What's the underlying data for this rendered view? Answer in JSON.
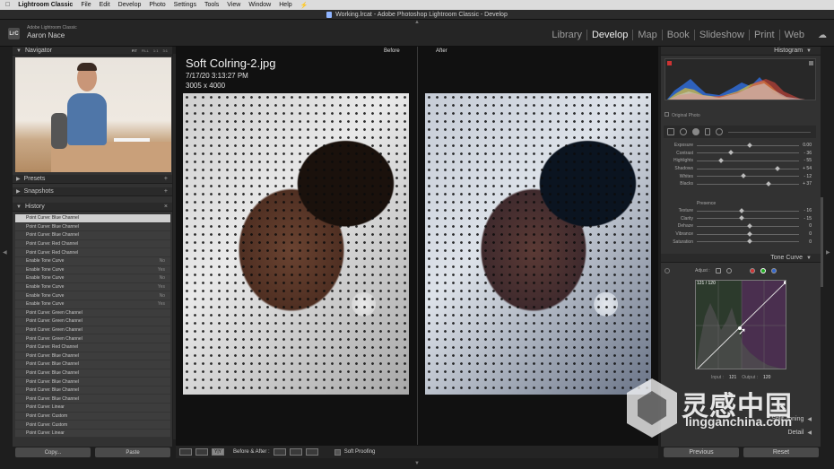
{
  "menubar": {
    "apple": "",
    "items": [
      "Lightroom Classic",
      "File",
      "Edit",
      "Develop",
      "Photo",
      "Settings",
      "Tools",
      "View",
      "Window",
      "Help"
    ],
    "right_icon": "⚡"
  },
  "window": {
    "title": "Working.lrcat - Adobe Photoshop Lightroom Classic - Develop"
  },
  "identity": {
    "logo": "LrC",
    "line1": "Adobe Lightroom Classic",
    "line2": "Aaron Nace"
  },
  "modules": {
    "items": [
      "Library",
      "Develop",
      "Map",
      "Book",
      "Slideshow",
      "Print",
      "Web"
    ],
    "active": "Develop",
    "cloud_icon": "☁"
  },
  "left": {
    "navigator": {
      "title": "Navigator",
      "zoom_options": [
        "FIT",
        "FILL",
        "1:1",
        "3:1"
      ]
    },
    "presets": {
      "title": "Presets"
    },
    "snapshots": {
      "title": "Snapshots"
    },
    "history": {
      "title": "History",
      "items": [
        {
          "label": "Point Curve: Blue Channel",
          "value": ""
        },
        {
          "label": "Point Curve: Blue Channel",
          "value": ""
        },
        {
          "label": "Point Curve: Blue Channel",
          "value": ""
        },
        {
          "label": "Point Curve: Red Channel",
          "value": ""
        },
        {
          "label": "Point Curve: Red Channel",
          "value": ""
        },
        {
          "label": "Enable Tone Curve",
          "value": "No"
        },
        {
          "label": "Enable Tone Curve",
          "value": "Yes"
        },
        {
          "label": "Enable Tone Curve",
          "value": "No"
        },
        {
          "label": "Enable Tone Curve",
          "value": "Yes"
        },
        {
          "label": "Enable Tone Curve",
          "value": "No"
        },
        {
          "label": "Enable Tone Curve",
          "value": "Yes"
        },
        {
          "label": "Point Curve: Green Channel",
          "value": ""
        },
        {
          "label": "Point Curve: Green Channel",
          "value": ""
        },
        {
          "label": "Point Curve: Green Channel",
          "value": ""
        },
        {
          "label": "Point Curve: Green Channel",
          "value": ""
        },
        {
          "label": "Point Curve: Red Channel",
          "value": ""
        },
        {
          "label": "Point Curve: Blue Channel",
          "value": ""
        },
        {
          "label": "Point Curve: Blue Channel",
          "value": ""
        },
        {
          "label": "Point Curve: Blue Channel",
          "value": ""
        },
        {
          "label": "Point Curve: Blue Channel",
          "value": ""
        },
        {
          "label": "Point Curve: Blue Channel",
          "value": ""
        },
        {
          "label": "Point Curve: Blue Channel",
          "value": ""
        },
        {
          "label": "Point Curve: Linear",
          "value": ""
        },
        {
          "label": "Point Curve: Custom",
          "value": ""
        },
        {
          "label": "Point Curve: Custom",
          "value": ""
        },
        {
          "label": "Point Curve: Linear",
          "value": ""
        }
      ]
    },
    "copy_label": "Copy...",
    "paste_label": "Paste"
  },
  "center": {
    "before_label": "Before",
    "after_label": "After",
    "filename": "Soft Colring-2.jpg",
    "datetime": "7/17/20 3:13:27 PM",
    "dimensions": "3005 x 4000"
  },
  "toolbar": {
    "view_label": "Before & After :",
    "soft_proofing": "Soft Proofing",
    "yy_label": "Y|Y"
  },
  "right": {
    "histogram_title": "Histogram",
    "original_photo": "Original Photo",
    "basic_sliders": [
      {
        "label": "Exposure",
        "value": "0.00",
        "pos": 0.5
      },
      {
        "label": "Contrast",
        "value": "- 36",
        "pos": 0.32
      },
      {
        "label": "Highlights",
        "value": "- 55",
        "pos": 0.22
      },
      {
        "label": "Shadows",
        "value": "+ 54",
        "pos": 0.77
      },
      {
        "label": "Whites",
        "value": "- 12",
        "pos": 0.44
      },
      {
        "label": "Blacks",
        "value": "+ 37",
        "pos": 0.68
      }
    ],
    "presence_title": "Presence",
    "presence_sliders": [
      {
        "label": "Texture",
        "value": "- 16",
        "pos": 0.42
      },
      {
        "label": "Clarity",
        "value": "- 15",
        "pos": 0.42
      },
      {
        "label": "Dehaze",
        "value": "0",
        "pos": 0.5
      },
      {
        "label": "Vibrance",
        "value": "0",
        "pos": 0.5
      },
      {
        "label": "Saturation",
        "value": "0",
        "pos": 0.5
      }
    ],
    "tone_curve_title": "Tone Curve",
    "adjust_label": "Adjust :",
    "curve_readout": "121 / 120",
    "input_label": "Input :",
    "input_value": "121",
    "output_label": "Output :",
    "output_value": "120",
    "split_toning_title": "Split Toning",
    "detail_title": "Detail",
    "previous_label": "Previous",
    "reset_label": "Reset"
  },
  "watermark": {
    "title": "灵感中国",
    "subtitle": "lingganchina.com"
  }
}
